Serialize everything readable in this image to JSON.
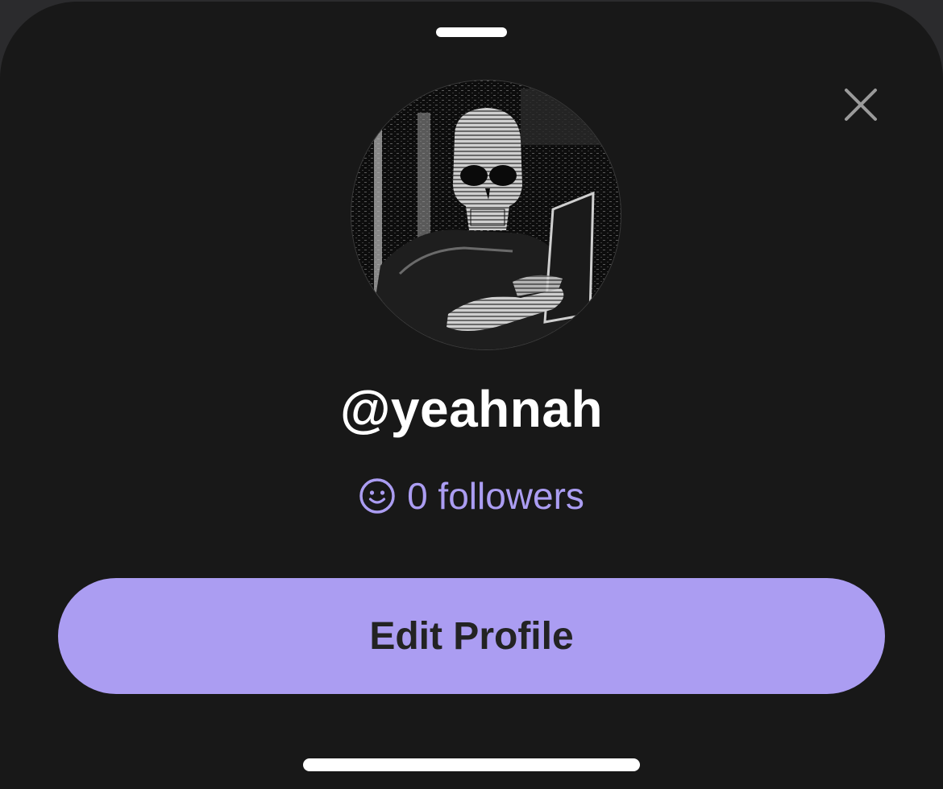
{
  "profile": {
    "username": "@yeahnah",
    "followers_text": "0 followers",
    "avatar_icon": "skull-hacker-avatar"
  },
  "actions": {
    "edit_profile_label": "Edit Profile",
    "close_icon": "close-icon"
  },
  "theme": {
    "sheet_background": "#181818",
    "accent": "#ab9df2",
    "button_text": "#232323",
    "text_primary": "#ffffff"
  }
}
